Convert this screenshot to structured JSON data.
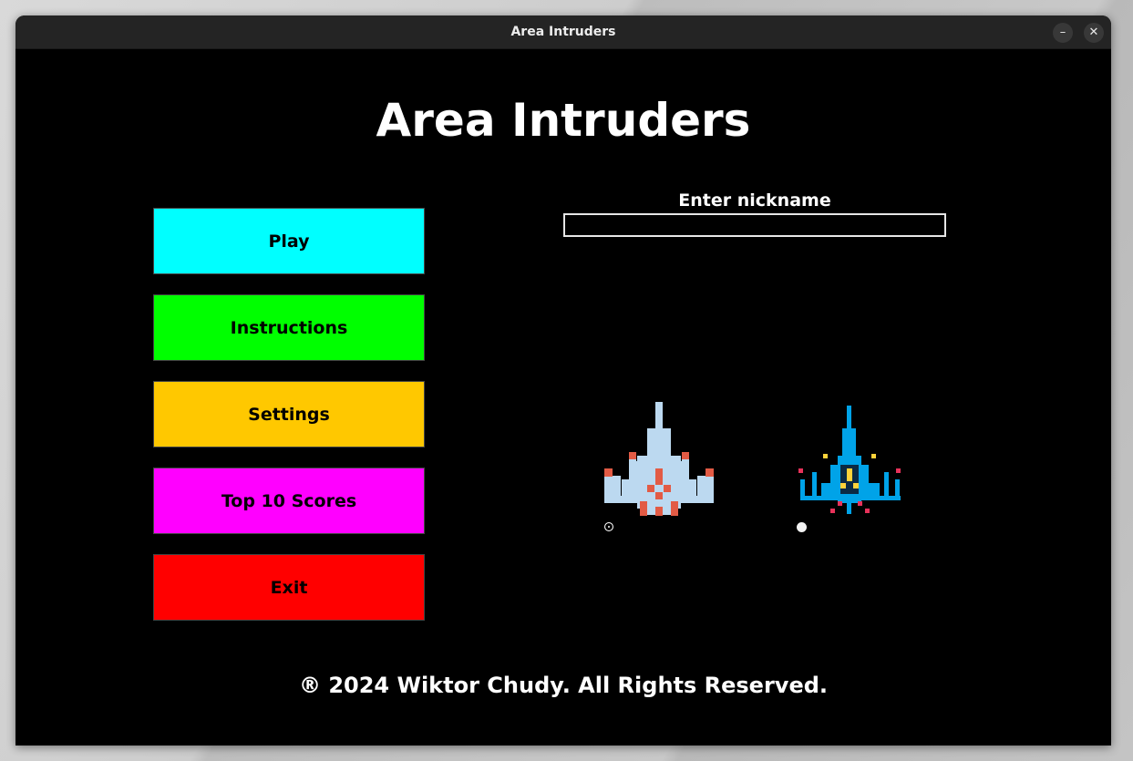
{
  "window": {
    "title": "Area Intruders"
  },
  "titlebar": {
    "minimize_glyph": "–",
    "close_glyph": "✕"
  },
  "game": {
    "title": "Area Intruders"
  },
  "menu": {
    "buttons": [
      {
        "label": "Play",
        "color": "#00ffff"
      },
      {
        "label": "Instructions",
        "color": "#00ff00"
      },
      {
        "label": "Settings",
        "color": "#ffc800"
      },
      {
        "label": "Top 10 Scores",
        "color": "#ff00ff"
      },
      {
        "label": "Exit",
        "color": "#ff0000"
      }
    ]
  },
  "nickname": {
    "label": "Enter nickname",
    "value": ""
  },
  "ships": [
    {
      "icon": "light-blue-spaceship-icon",
      "body_color": "#bcd9f0",
      "accent_color": "#e25b45"
    },
    {
      "icon": "blue-spaceship-icon",
      "body_color": "#00a3e8",
      "accent_color": "#e8325a"
    }
  ],
  "footer": {
    "copyright": "® 2024 Wiktor Chudy. All Rights Reserved."
  }
}
